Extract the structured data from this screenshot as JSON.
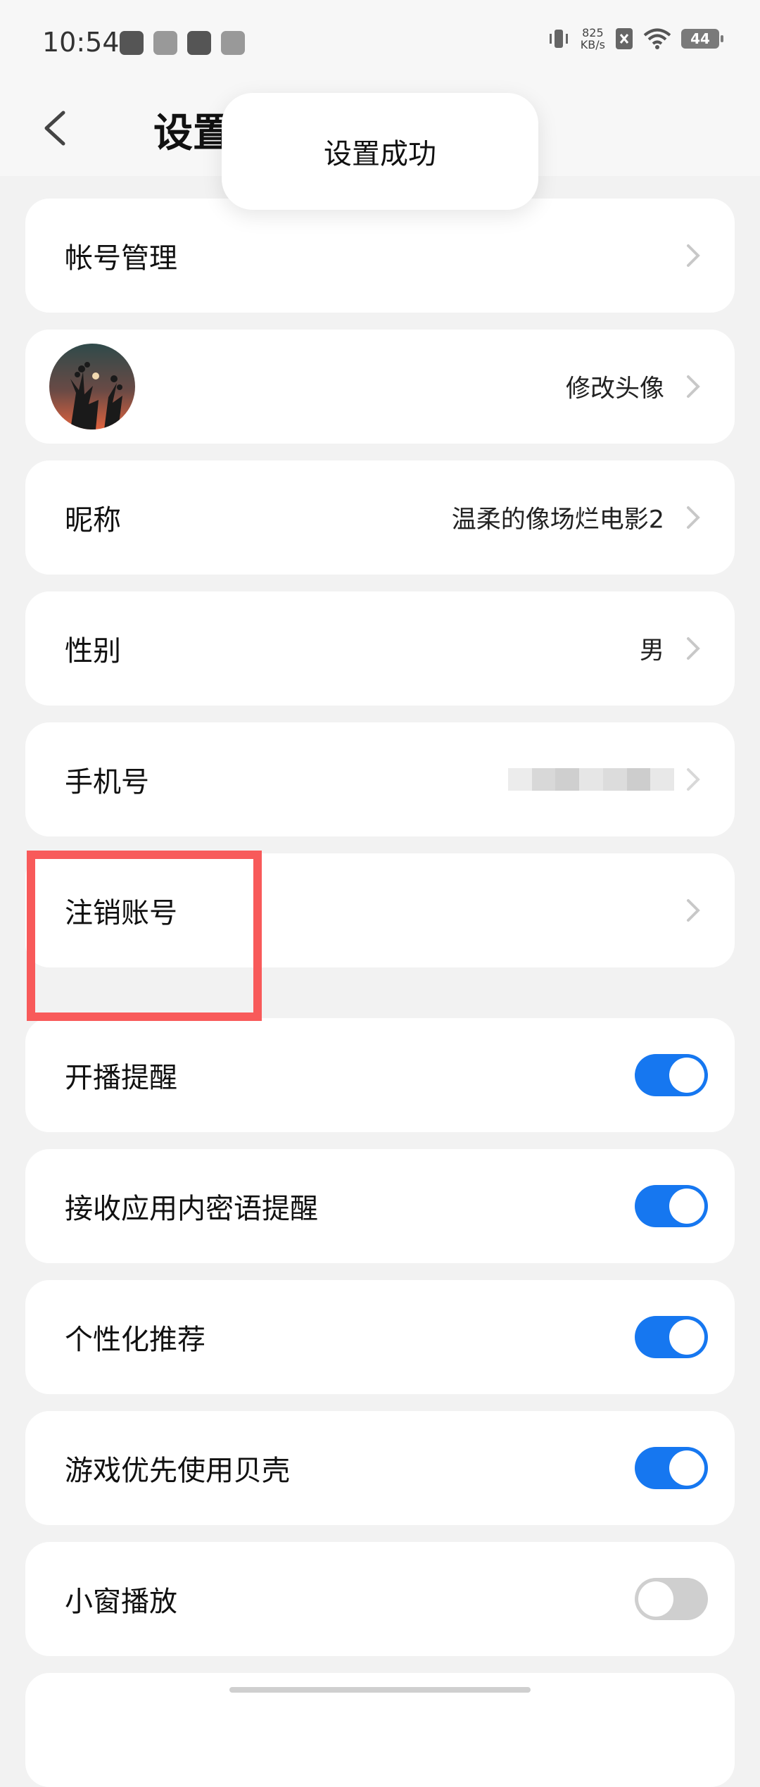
{
  "status_bar": {
    "time": "10:54",
    "net_speed_value": "825",
    "net_speed_unit": "KB/s",
    "battery": "44"
  },
  "header": {
    "title": "设置",
    "back_icon": "chevron-left-icon"
  },
  "toast": {
    "message": "设置成功"
  },
  "settings": [
    {
      "label": "帐号管理",
      "value": ""
    },
    {
      "label": "",
      "value": "修改头像"
    },
    {
      "label": "昵称",
      "value": "温柔的像场烂电影2"
    },
    {
      "label": "性别",
      "value": "男"
    },
    {
      "label": "手机号",
      "value": ""
    },
    {
      "label": "注销账号",
      "value": ""
    },
    {
      "label": "开播提醒",
      "toggle": true
    },
    {
      "label": "接收应用内密语提醒",
      "toggle": true
    },
    {
      "label": "个性化推荐",
      "toggle": true
    },
    {
      "label": "游戏优先使用贝壳",
      "toggle": true
    },
    {
      "label": "小窗播放",
      "toggle": false
    }
  ],
  "colors": {
    "toggle_on": "#1677f0",
    "toggle_off": "#cfcfcf",
    "highlight": "#f85a5a"
  }
}
